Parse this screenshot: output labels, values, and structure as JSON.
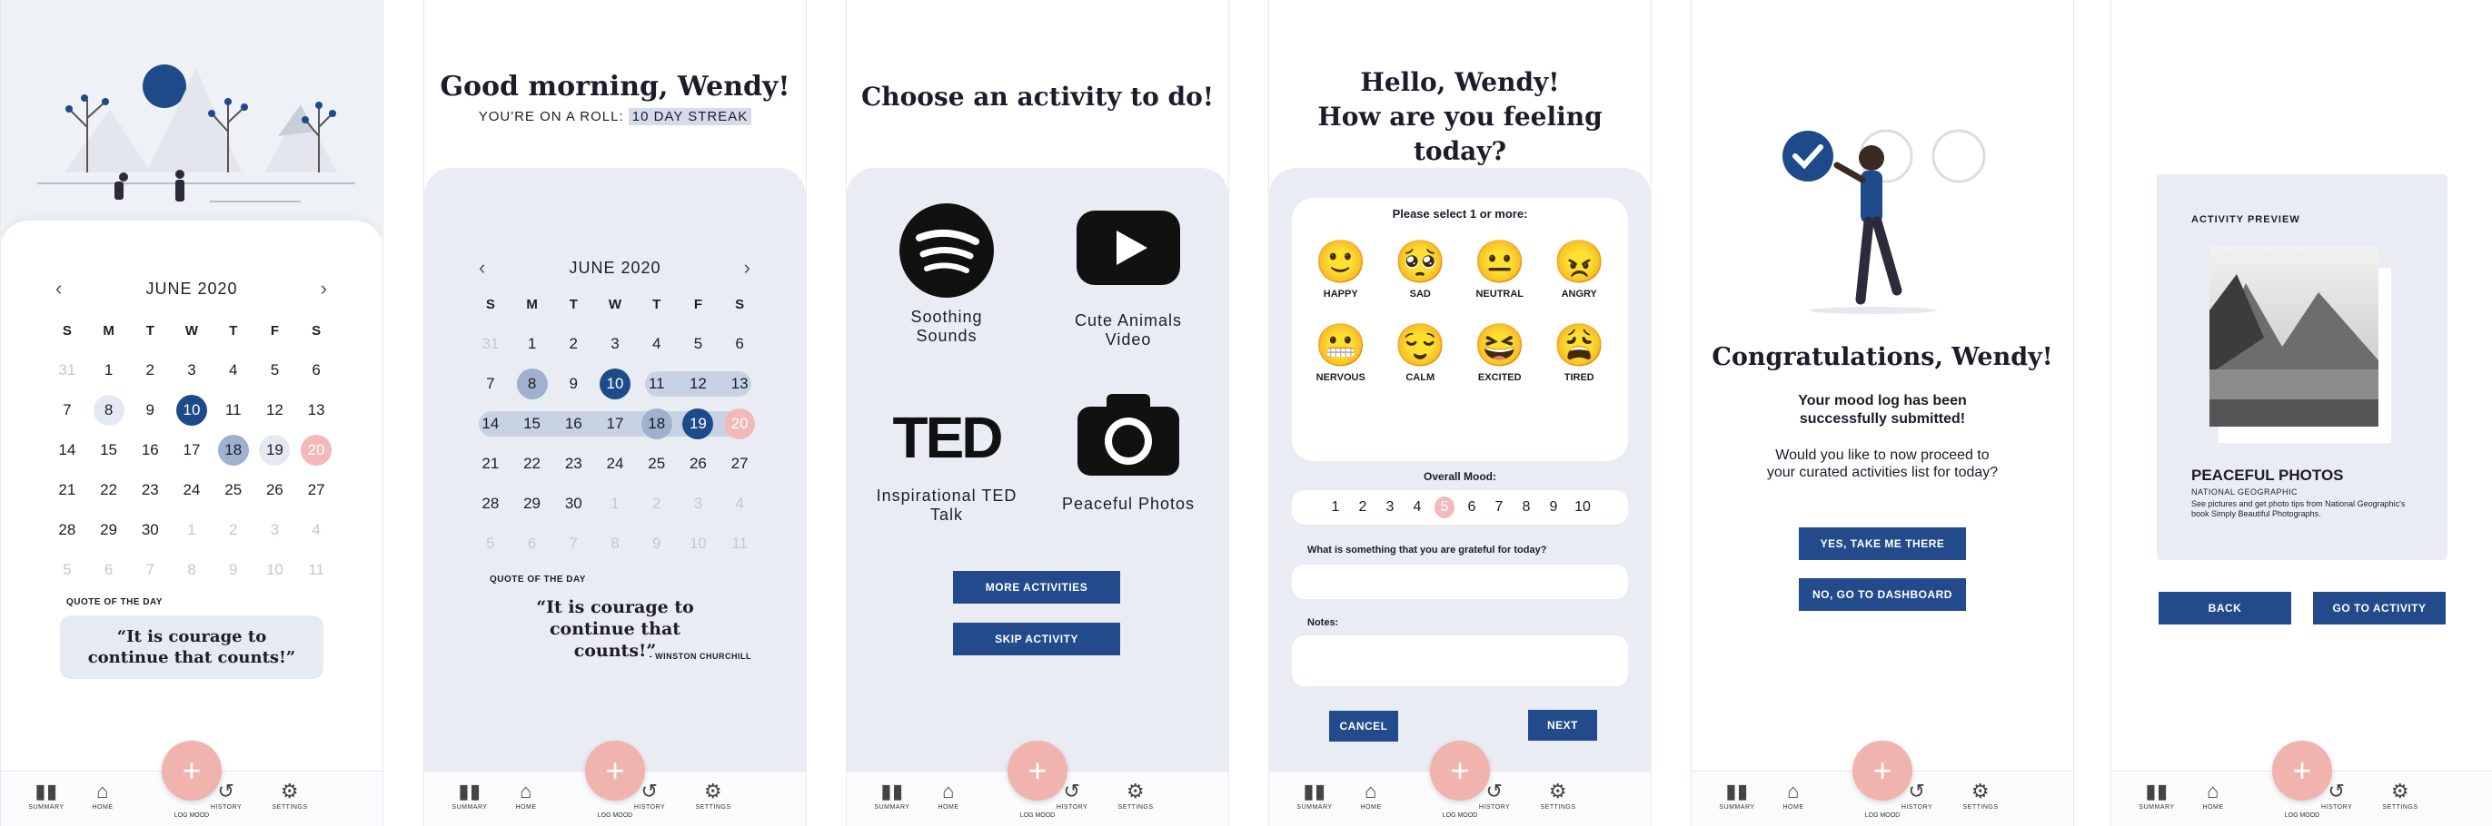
{
  "colors": {
    "navy": "#234b8c",
    "pink": "#f1b3ad",
    "panel": "#e9edf3"
  },
  "nav": [
    {
      "icon": "bar-chart-icon",
      "glyph": "▮▮",
      "label": "SUMMARY"
    },
    {
      "icon": "home-icon",
      "glyph": "⌂",
      "label": "HOME"
    },
    {
      "icon": "plus-icon",
      "glyph": "+",
      "label": "LOG MOOD"
    },
    {
      "icon": "history-icon",
      "glyph": "↺",
      "label": "HISTORY"
    },
    {
      "icon": "gear-icon",
      "glyph": "⚙",
      "label": "SETTINGS"
    }
  ],
  "calendar": {
    "month": "JUNE 2020",
    "prev": "‹",
    "next": "›",
    "weekdays": [
      "S",
      "M",
      "T",
      "W",
      "T",
      "F",
      "S"
    ],
    "days": [
      "31",
      "1",
      "2",
      "3",
      "4",
      "5",
      "6",
      "7",
      "8",
      "9",
      "10",
      "11",
      "12",
      "13",
      "14",
      "15",
      "16",
      "17",
      "18",
      "19",
      "20",
      "21",
      "22",
      "23",
      "24",
      "25",
      "26",
      "27",
      "28",
      "29",
      "30",
      "1",
      "2",
      "3",
      "4",
      "5",
      "6",
      "7",
      "8",
      "9",
      "10",
      "11"
    ]
  },
  "quote": {
    "label": "QUOTE OF THE DAY",
    "text": "“It is courage to continue that counts!”",
    "author": "- WINSTON CHURCHILL"
  },
  "screen2": {
    "greeting": "Good morning, Wendy!",
    "streak_prefix": "YOU'RE ON A ROLL: ",
    "streak": "10 DAY STREAK"
  },
  "screen3": {
    "title": "Choose an activity to do!",
    "activities": [
      {
        "name": "Soothing Sounds",
        "icon": "spotify-icon"
      },
      {
        "name": "Cute Animals Video",
        "icon": "youtube-icon"
      },
      {
        "name": "Inspirational TED Talk",
        "icon": "ted-logo"
      },
      {
        "name": "Peaceful Photos",
        "icon": "camera-icon"
      }
    ],
    "more": "MORE ACTIVITIES",
    "skip": "SKIP ACTIVITY"
  },
  "screen4": {
    "title_line1": "Hello, Wendy!",
    "title_line2": "How are you feeling today?",
    "select_prompt": "Please select 1 or more:",
    "moods": [
      {
        "emoji": "🙂",
        "label": "HAPPY"
      },
      {
        "emoji": "🥺",
        "label": "SAD"
      },
      {
        "emoji": "😐",
        "label": "NEUTRAL"
      },
      {
        "emoji": "😠",
        "label": "ANGRY"
      },
      {
        "emoji": "😬",
        "label": "NERVOUS"
      },
      {
        "emoji": "😌",
        "label": "CALM"
      },
      {
        "emoji": "😆",
        "label": "EXCITED"
      },
      {
        "emoji": "😩",
        "label": "TIRED"
      }
    ],
    "overall_label": "Overall Mood:",
    "scale": [
      "1",
      "2",
      "3",
      "4",
      "5",
      "6",
      "7",
      "8",
      "9",
      "10"
    ],
    "selected_score": 5,
    "grateful_q": "What is something that you are grateful for today?",
    "notes_label": "Notes:",
    "cancel": "CANCEL",
    "next": "NEXT"
  },
  "screen5": {
    "title": "Congratulations, Wendy!",
    "line1": "Your mood log has been successfully submitted!",
    "line2": "Would you like to now proceed to your curated activities list for today?",
    "yes": "YES, TAKE ME THERE",
    "no": "NO, GO TO DASHBOARD"
  },
  "screen6": {
    "preview_label": "ACTIVITY PREVIEW",
    "name": "PEACEFUL PHOTOS",
    "source": "NATIONAL GEOGRAPHIC",
    "desc": "See pictures and get photo tips from National Geographic's book Simply Beautiful Photographs.",
    "back": "BACK",
    "go": "GO TO ACTIVITY"
  }
}
